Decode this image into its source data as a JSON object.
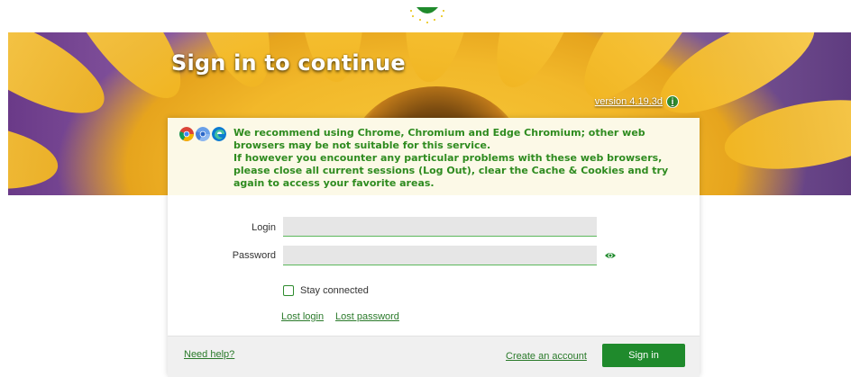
{
  "header": {
    "title": "Sign in to continue",
    "version": "version 4.19.3d"
  },
  "notice": {
    "line1": "We recommend using Chrome, Chromium and Edge Chromium; other web browsers may be not suitable for this service.",
    "line2": "If however you encounter any particular problems with these web browsers, please close all current sessions (Log Out), clear the Cache & Cookies and try again to access your favorite areas."
  },
  "form": {
    "login_label": "Login",
    "login_value": "",
    "password_label": "Password",
    "password_value": "",
    "stay_connected_label": "Stay connected",
    "stay_connected_checked": false,
    "lost_login": "Lost login",
    "lost_password": "Lost password"
  },
  "footer": {
    "need_help": "Need help?",
    "create_account": "Create an account",
    "sign_in": "Sign in"
  },
  "colors": {
    "accent": "#1f8a2c",
    "notice_text": "#2e8b1f"
  }
}
